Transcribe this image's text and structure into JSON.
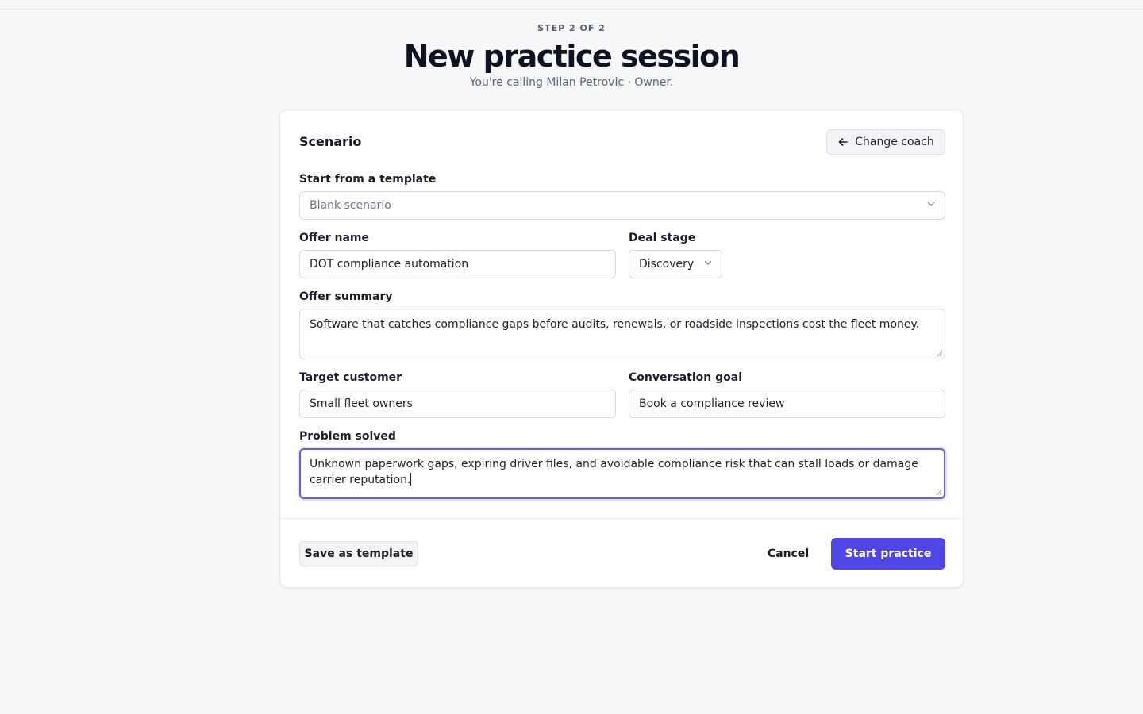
{
  "header": {
    "step": "STEP 2 OF 2",
    "title": "New practice session",
    "subtitle": "You're calling Milan Petrovic · Owner."
  },
  "card": {
    "title": "Scenario",
    "change_coach_label": "Change coach",
    "template": {
      "label": "Start from a template",
      "selected": "Blank scenario"
    },
    "offer_name": {
      "label": "Offer name",
      "value": "DOT compliance automation"
    },
    "deal_stage": {
      "label": "Deal stage",
      "selected": "Discovery"
    },
    "offer_summary": {
      "label": "Offer summary",
      "value": "Software that catches compliance gaps before audits, renewals, or roadside inspections cost the fleet money."
    },
    "target_customer": {
      "label": "Target customer",
      "value": "Small fleet owners"
    },
    "conversation_goal": {
      "label": "Conversation goal",
      "value": "Book a compliance review"
    },
    "problem_solved": {
      "label": "Problem solved",
      "value": "Unknown paperwork gaps, expiring driver files, and avoidable compliance risk that can stall loads or damage carrier reputation."
    }
  },
  "footer": {
    "save_template_label": "Save as template",
    "cancel_label": "Cancel",
    "start_label": "Start practice"
  },
  "icons": {
    "arrow": "arrow-left-icon",
    "chevron": "chevron-down-icon"
  },
  "colors": {
    "accent": "#4f46e5",
    "focus_ring": "#6b5cf0",
    "background": "#f6f7f9"
  }
}
